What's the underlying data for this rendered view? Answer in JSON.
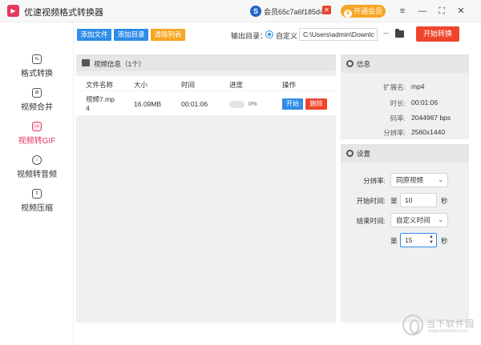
{
  "window": {
    "title": "优速视频格式转换器",
    "logo_glyph": "▶",
    "member_text": "会员65c7a6f185d4",
    "member_glyph": "S",
    "vip_button": "开通会员",
    "controls": {
      "menu": "≡",
      "minimize": "—",
      "maximize": "⛶",
      "close": "✕"
    }
  },
  "sidebar": {
    "items": [
      {
        "label": "格式转换",
        "icon": "format-icon",
        "glyph": "⇆",
        "active": false
      },
      {
        "label": "视频合并",
        "icon": "merge-icon",
        "glyph": "⊞",
        "active": false
      },
      {
        "label": "视频转GIF",
        "icon": "gif-icon",
        "glyph": "GIF",
        "active": true
      },
      {
        "label": "视频转音频",
        "icon": "audio-icon",
        "glyph": "♪",
        "active": false
      },
      {
        "label": "视频压缩",
        "icon": "compress-icon",
        "glyph": "⇕",
        "active": false
      }
    ]
  },
  "toolbar": {
    "add_file": "添加文件",
    "add_dir": "添加目录",
    "clear_list": "清除列表",
    "output_label": "输出目录：",
    "custom_label": "自定义",
    "output_path": "C:\\Users\\admin\\Downlc",
    "more": "···",
    "convert": "开始转换"
  },
  "file_panel": {
    "title": "视频信息（1个）",
    "columns": [
      "文件名称",
      "大小",
      "时间",
      "进度",
      "操作"
    ],
    "rows": [
      {
        "name_line1": "视频7.mp",
        "name_line2": "4",
        "size": "16.09MB",
        "duration": "00:01:06",
        "progress_text": "0%",
        "progress": 0,
        "start": "开始",
        "delete": "删除"
      }
    ]
  },
  "info_panel": {
    "title": "信息",
    "fields": [
      {
        "label": "扩展名:",
        "value": "mp4"
      },
      {
        "label": "时长:",
        "value": "00:01:06"
      },
      {
        "label": "码率:",
        "value": "2044967 bps"
      },
      {
        "label": "分辨率:",
        "value": "2560x1440"
      }
    ]
  },
  "settings_panel": {
    "title": "设置",
    "resolution_label": "分辨率:",
    "resolution_value": "同原视频",
    "start_label": "开始时间:",
    "start_prefix": "第",
    "start_value": "10",
    "start_unit": "秒",
    "end_label": "结束时间:",
    "end_mode": "自定义时间",
    "end_prefix": "第",
    "end_value": "15",
    "end_unit": "秒"
  }
}
